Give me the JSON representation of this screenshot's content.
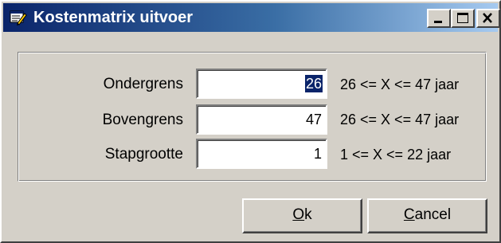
{
  "window": {
    "title": "Kostenmatrix uitvoer",
    "icons": [
      "app-icon",
      "minimize-icon",
      "maximize-icon",
      "close-icon"
    ],
    "title_colors": {
      "start": "#0a246a",
      "end": "#a6caf0"
    }
  },
  "form": {
    "rows": [
      {
        "label": "Ondergrens",
        "value": "26",
        "range": "26 <= X <= 47 jaar",
        "selected": true
      },
      {
        "label": "Bovengrens",
        "value": "47",
        "range": "26 <= X <= 47 jaar",
        "selected": false
      },
      {
        "label": "Stapgrootte",
        "value": "1",
        "range": "1 <= X <= 22 jaar",
        "selected": false
      }
    ]
  },
  "buttons": {
    "ok_mnemonic": "O",
    "ok_rest": "k",
    "cancel_mnemonic": "C",
    "cancel_rest": "ancel"
  }
}
